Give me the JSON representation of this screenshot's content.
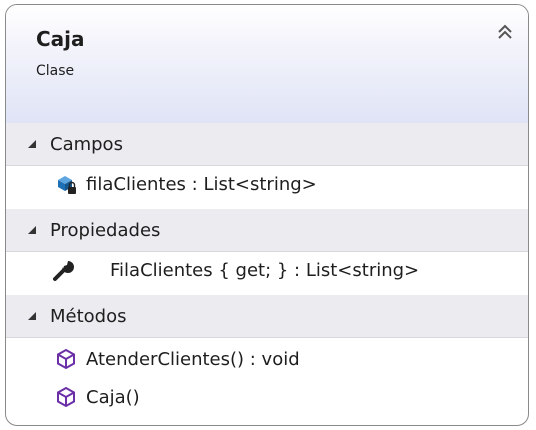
{
  "class": {
    "name": "Caja",
    "stereotype": "Clase",
    "collapse_icon": "double-chevron-up-icon"
  },
  "sections": {
    "fields": {
      "label": "Campos",
      "items": [
        {
          "text": "filaClientes : List<string>",
          "icon": "private-field-icon"
        }
      ]
    },
    "properties": {
      "label": "Propiedades",
      "items": [
        {
          "text": "FilaClientes { get; } : List<string>",
          "icon": "wrench-property-icon"
        }
      ]
    },
    "methods": {
      "label": "Métodos",
      "items": [
        {
          "text": "AtenderClientes() : void",
          "icon": "method-cube-icon"
        },
        {
          "text": "Caja()",
          "icon": "method-cube-icon"
        }
      ]
    }
  },
  "colors": {
    "border": "#8a8a8a",
    "header_gradient_end": "#dfe3f5",
    "section_bg": "#ebebf0",
    "field_icon": "#1f6fb4",
    "method_icon": "#6b2fa8"
  }
}
